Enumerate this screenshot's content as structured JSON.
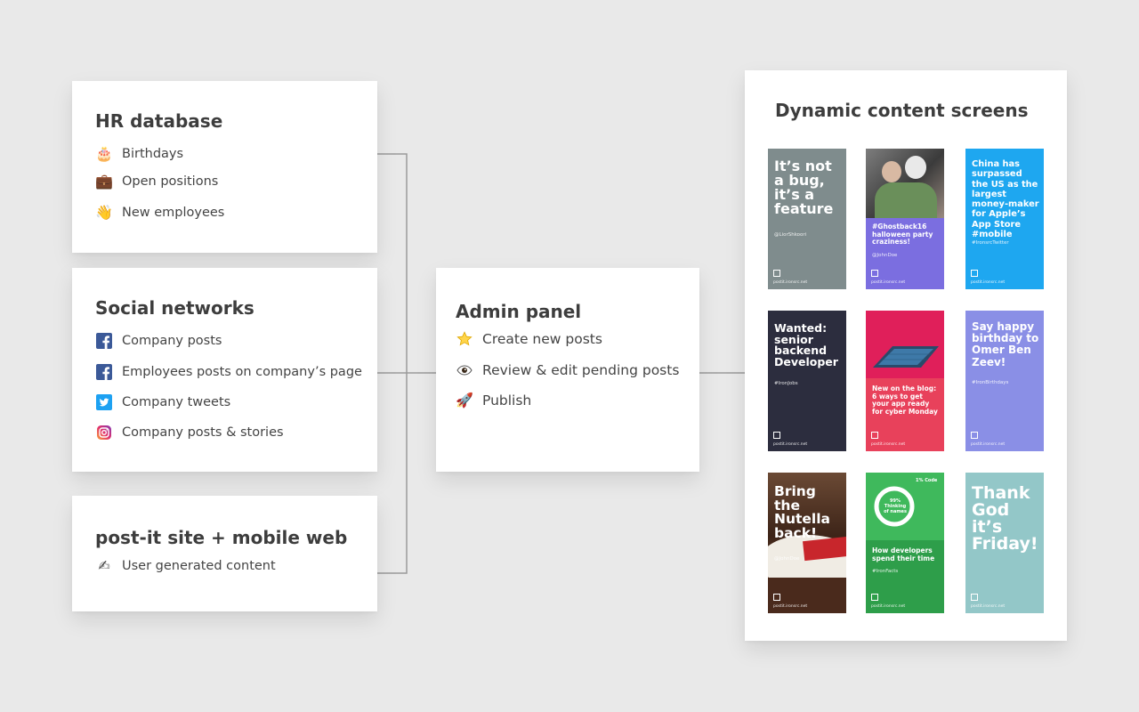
{
  "hr": {
    "title": "HR database",
    "items": [
      {
        "icon": "birthday-cake-icon",
        "label": "Birthdays"
      },
      {
        "icon": "briefcase-icon",
        "label": "Open positions"
      },
      {
        "icon": "waving-hand-icon",
        "label": "New employees"
      }
    ]
  },
  "social": {
    "title": "Social networks",
    "items": [
      {
        "icon": "facebook-icon",
        "label": "Company posts"
      },
      {
        "icon": "facebook-icon",
        "label": "Employees posts on company’s page"
      },
      {
        "icon": "twitter-icon",
        "label": "Company tweets"
      },
      {
        "icon": "instagram-icon",
        "label": "Company posts & stories"
      }
    ]
  },
  "site": {
    "title": "post-it site + mobile web",
    "items": [
      {
        "icon": "writing-hand-icon",
        "label": "User generated content"
      }
    ]
  },
  "admin": {
    "title": "Admin panel",
    "items": [
      {
        "icon": "star-icon",
        "label": "Create new posts"
      },
      {
        "icon": "eye-icon",
        "label": "Review & edit pending posts"
      },
      {
        "icon": "rocket-icon",
        "label": "Publish"
      }
    ]
  },
  "screens": {
    "title": "Dynamic content screens",
    "url": "postit.ironsrc.net",
    "tiles": [
      {
        "bg": "#7f8c8d",
        "headline": "It’s not a bug, it’s a feature",
        "handle": "@LiorShkoori",
        "body": ""
      },
      {
        "bg": "#7b6ee0",
        "headline": "",
        "handle": "@JohnDoe",
        "body": "#Ghostback16 halloween party craziness!"
      },
      {
        "bg": "#1ea7f0",
        "headline": "China has surpassed the US as the largest money-maker for Apple’s App Store #mobile",
        "handle": "#IronsrcTwitter",
        "body": ""
      },
      {
        "bg": "#2c2d3e",
        "headline": "Wanted: senior backend Developer",
        "handle": "#IronJobs",
        "body": ""
      },
      {
        "bg": "#e8415b",
        "headline": "",
        "handle": "",
        "body": "New on the blog: 6 ways to get your app ready for cyber Monday"
      },
      {
        "bg": "#8a8fe6",
        "headline": "Say happy birthday to Omer Ben Zeev!",
        "handle": "#IronBirthdays",
        "body": ""
      },
      {
        "bg": "#5a3a2a",
        "headline": "Bring the Nutella back!",
        "handle": "@JohnDoe",
        "body": ""
      },
      {
        "bg": "#2e9e4a",
        "headline": "",
        "handle": "#IronFacts",
        "body": "How developers spend their time",
        "stat_small": "1% Code",
        "stat_big": "99% Thinking of names"
      },
      {
        "bg": "#93c7c8",
        "headline": "Thank God it’s Friday!",
        "handle": "",
        "body": ""
      }
    ]
  }
}
